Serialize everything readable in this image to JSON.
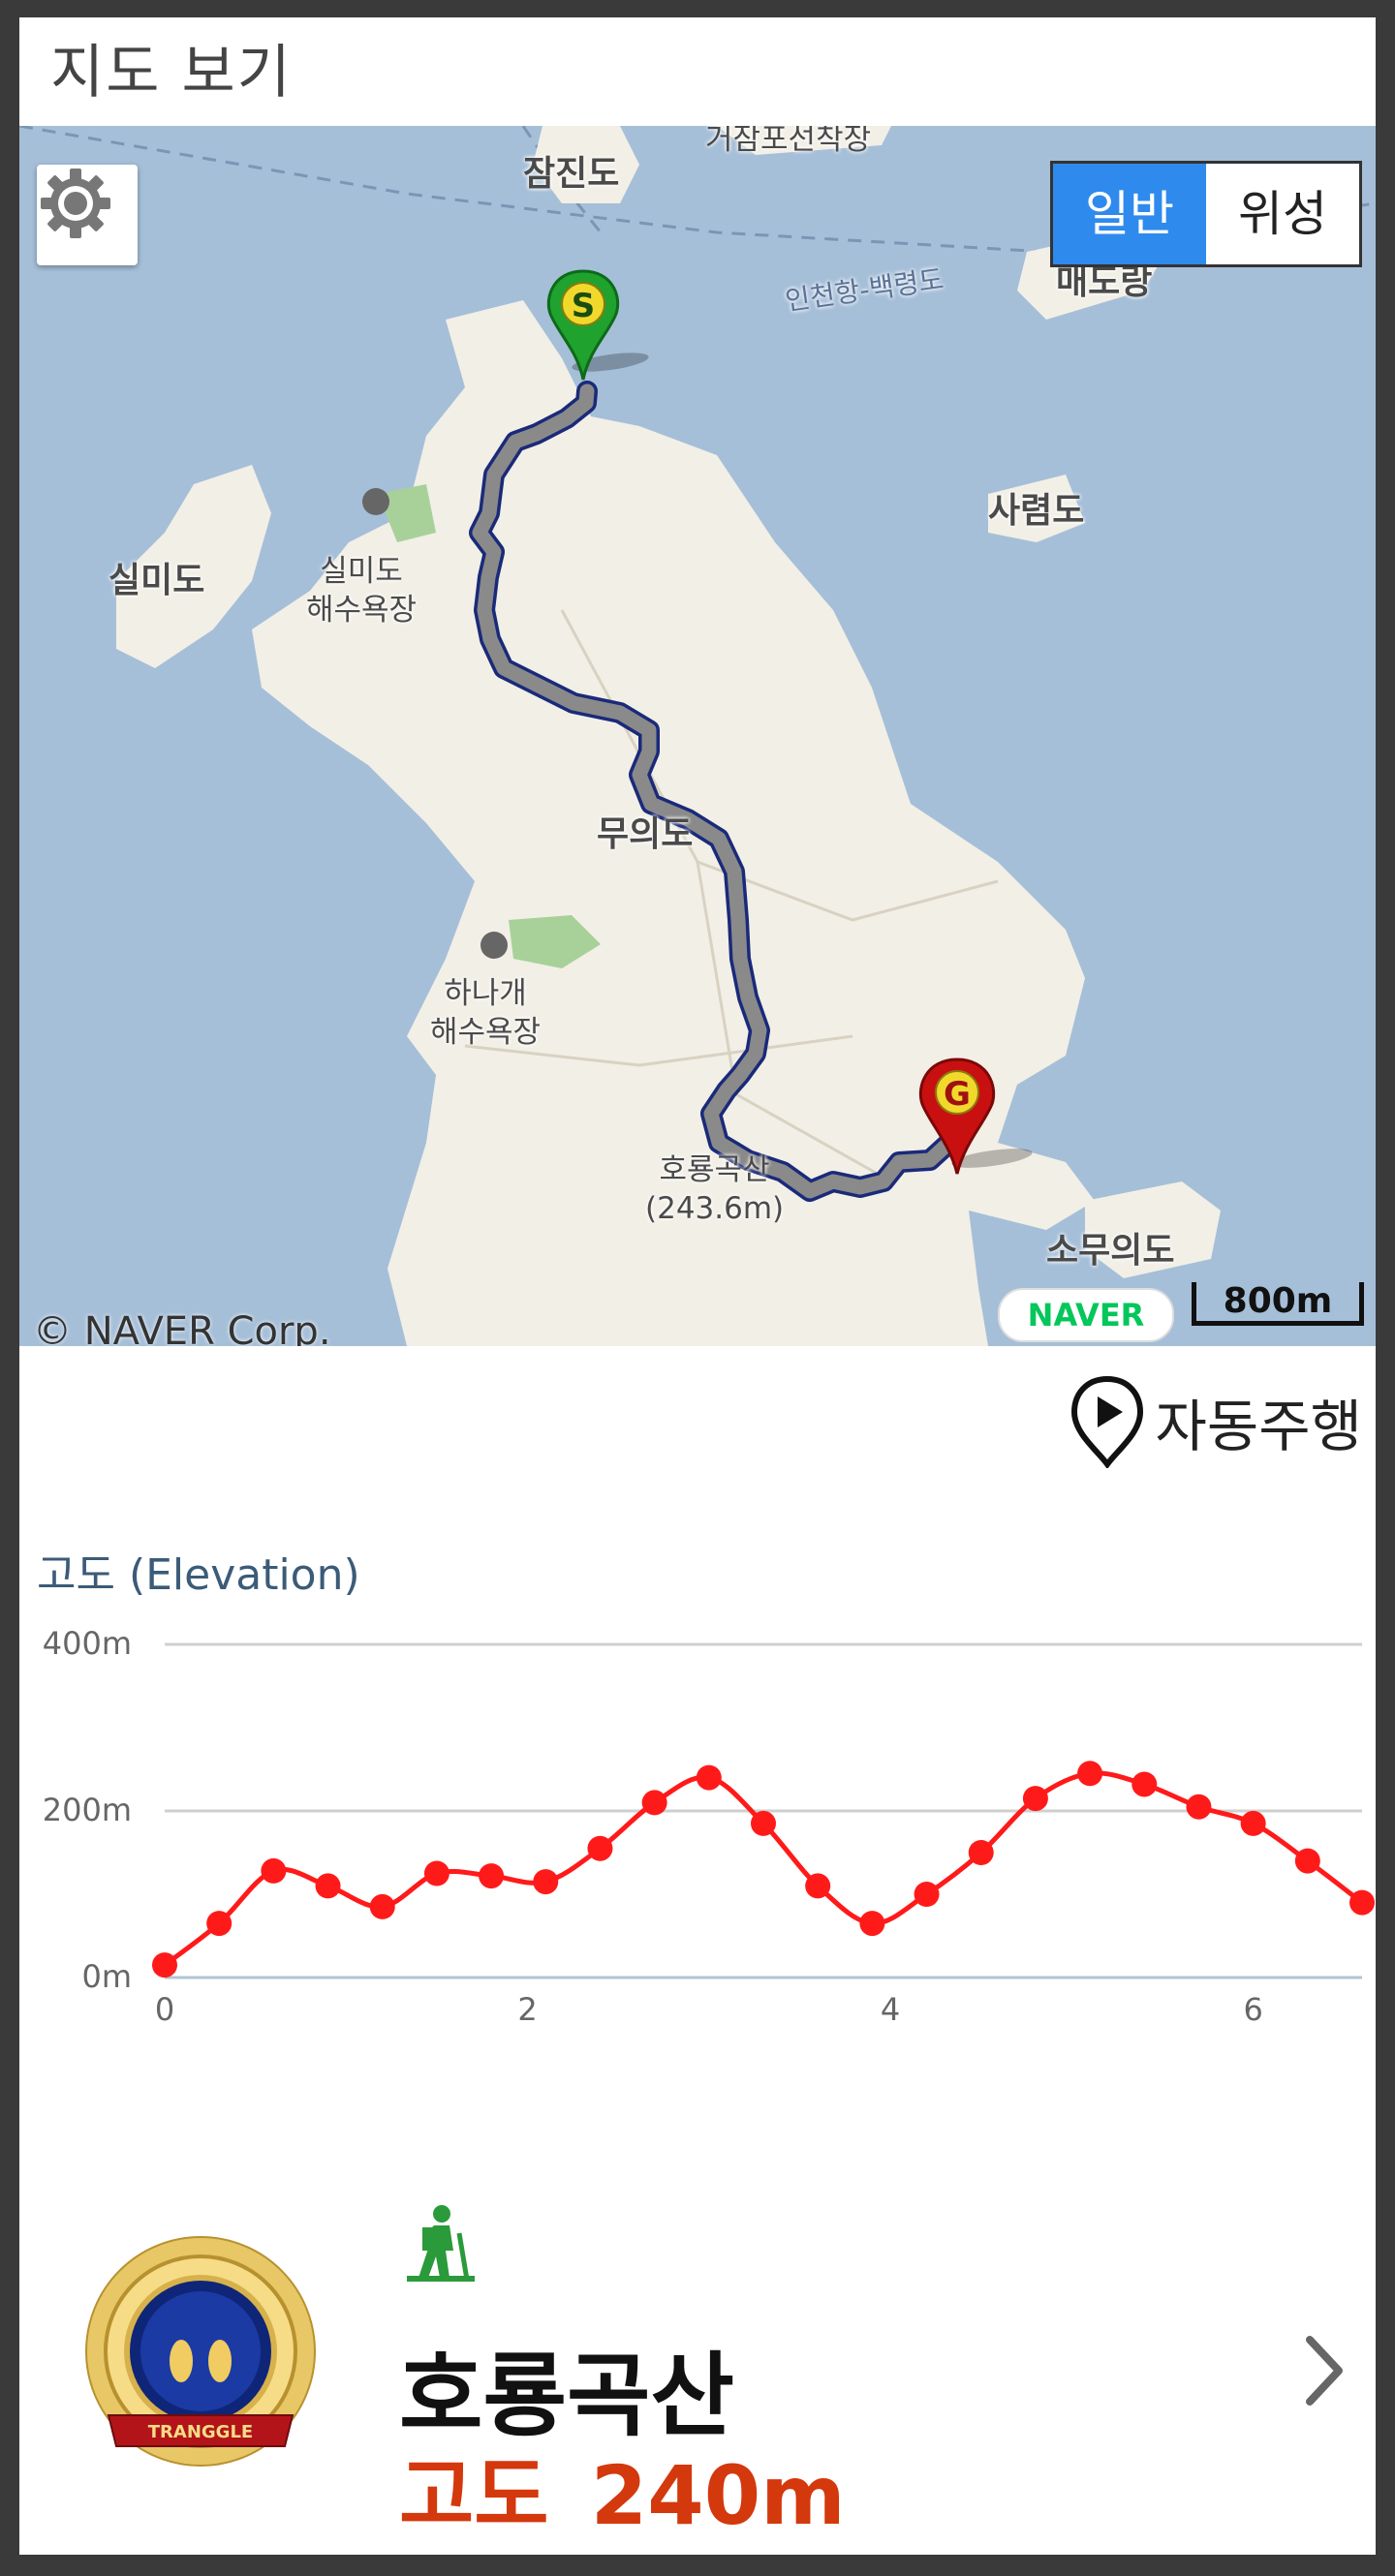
{
  "header": {
    "title": "지도 보기"
  },
  "map": {
    "mode_options": [
      "일반",
      "위성"
    ],
    "active_mode": "일반",
    "labels": {
      "jamjin": "잠진도",
      "geojam": "거잠포선착장",
      "ferry": "인천항-백령도",
      "maedo": "매도랑",
      "sillim": "실미도",
      "sillim_beach": "실미도\n해수욕장",
      "saryeom": "사렴도",
      "muui": "무의도",
      "hanagae": "하나개\n해수욕장",
      "horyong": "호룡곡산\n(243.6m)",
      "somuui": "소무의도"
    },
    "copyright": "© NAVER Corp.",
    "provider_badge": "NAVER",
    "scale": "800m",
    "start_marker": "S",
    "goal_marker": "G",
    "route_color": "#8a8a8a",
    "route_outline": "#1a2a7a"
  },
  "auto_drive": {
    "label": "자동주행",
    "icon": "map-pin-play-icon"
  },
  "elevation": {
    "title": "고도 (Elevation)",
    "line_color": "#ff1a1a"
  },
  "chart_data": {
    "type": "line",
    "title": "고도 (Elevation)",
    "xlabel": "",
    "ylabel": "",
    "x_ticks": [
      "0",
      "2",
      "4",
      "6"
    ],
    "y_ticks": [
      "0m",
      "200m",
      "400m"
    ],
    "xlim": [
      0,
      6.6
    ],
    "ylim": [
      0,
      400
    ],
    "grid": true,
    "series": [
      {
        "x": [
          0,
          0.3,
          0.6,
          0.9,
          1.2,
          1.5,
          1.8,
          2.1,
          2.4,
          2.7,
          3.0,
          3.3,
          3.6,
          3.9,
          4.2,
          4.5,
          4.8,
          5.1,
          5.4,
          5.7,
          6.0,
          6.3,
          6.6
        ],
        "y": [
          15,
          65,
          128,
          110,
          85,
          125,
          122,
          115,
          155,
          210,
          240,
          185,
          110,
          65,
          100,
          150,
          215,
          245,
          232,
          205,
          185,
          140,
          90
        ]
      }
    ]
  },
  "summit": {
    "name": "호룡곡산",
    "altitude": "고도  240m",
    "badge_text": "TRANGGLE",
    "hiker_icon": "hiker-icon",
    "chevron_icon": "chevron-right-icon"
  }
}
